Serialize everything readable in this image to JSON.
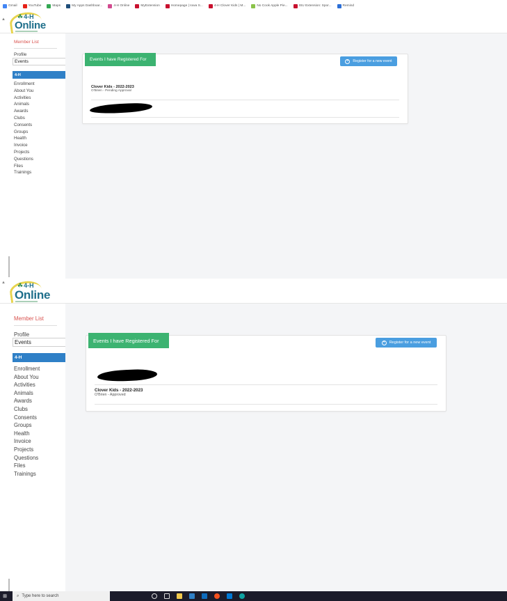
{
  "bookmarks": [
    {
      "label": "Gmail",
      "color": "#4285f4"
    },
    {
      "label": "YouTube",
      "color": "#e62117"
    },
    {
      "label": "Maps",
      "color": "#34a853"
    },
    {
      "label": "My Apps Dashboar...",
      "color": "#1f4e79"
    },
    {
      "label": "4-H Online",
      "color": "#d14b8f"
    },
    {
      "label": "MyExtension",
      "color": "#c8102e"
    },
    {
      "label": "Homepage | Iowa S...",
      "color": "#c8102e"
    },
    {
      "label": "4-H Clover Kids | M...",
      "color": "#c8102e"
    },
    {
      "label": "No Cook Apple Pie...",
      "color": "#8bc34a"
    },
    {
      "label": "ISU Extension: Spor...",
      "color": "#c8102e"
    },
    {
      "label": "Remind",
      "color": "#2c6fd6"
    }
  ],
  "logo": {
    "top": "4-H",
    "name": "Online"
  },
  "sidebar": {
    "member_list": "Member List",
    "profile": "Profile",
    "events": "Events",
    "section": "4-H",
    "items": [
      "Enrollment",
      "About You",
      "Activities",
      "Animals",
      "Awards",
      "Clubs",
      "Consents",
      "Groups",
      "Health",
      "Invoice",
      "Projects",
      "Questions",
      "Files",
      "Trainings"
    ]
  },
  "events_card": {
    "title": "Events I have Registered For",
    "register_button": "Register for a new event"
  },
  "panel1": {
    "event": {
      "name": "Clover Kids - 2022-2023",
      "status": "O'Brien - Pending Approval"
    }
  },
  "panel2": {
    "event": {
      "name": "Clover Kids - 2022-2023",
      "status": "O'Brien - Approved"
    }
  },
  "taskbar": {
    "search_placeholder": "Type here to search"
  }
}
